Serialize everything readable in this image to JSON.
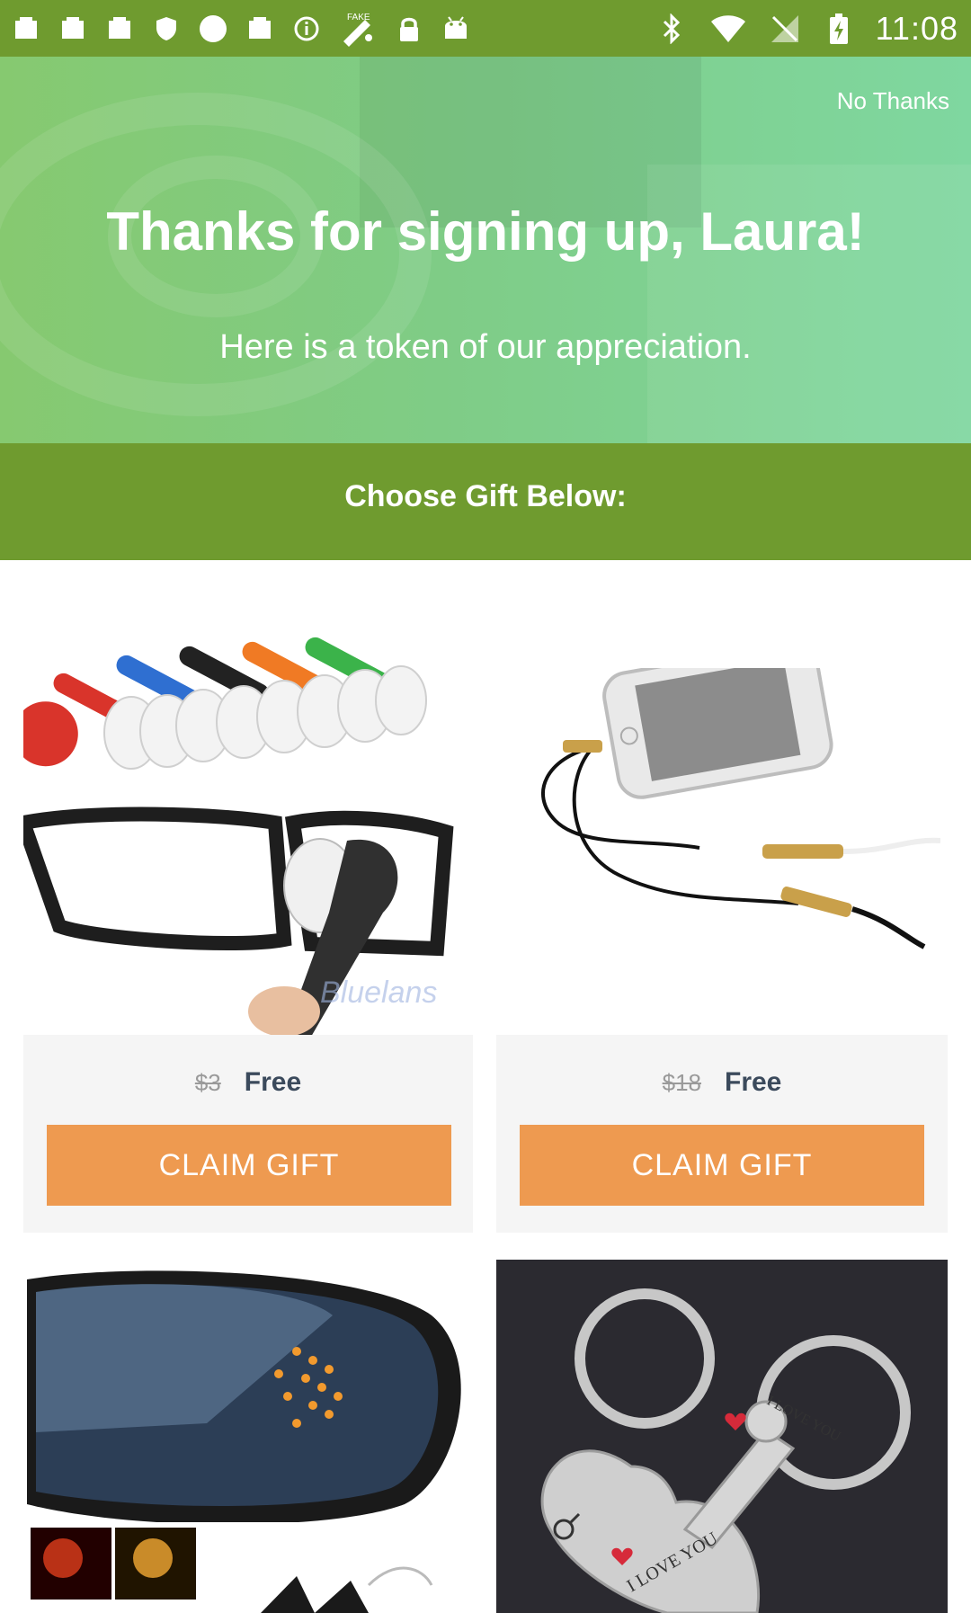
{
  "status_bar": {
    "time": "11:08",
    "left_icons": [
      "notification-icon",
      "notification-icon",
      "notification-icon",
      "shield-icon",
      "circle-icon",
      "notification-icon",
      "info-icon",
      "fake-gps-icon",
      "lock-icon",
      "android-icon"
    ],
    "right_icons": [
      "bluetooth-icon",
      "wifi-icon",
      "no-signal-icon",
      "battery-charging-icon"
    ],
    "fake_gps_label": "FAKE"
  },
  "overlay": {
    "no_thanks": "No Thanks",
    "title": "Thanks for signing up, Laura!",
    "subtitle": "Here is a token of our appreciation.",
    "choose_label": "Choose Gift Below:",
    "gifts": [
      {
        "old_price": "$3",
        "new_price": "Free",
        "button": "CLAIM GIFT",
        "image": "eyeglass-cleaner-clips"
      },
      {
        "old_price": "$18",
        "new_price": "Free",
        "button": "CLAIM GIFT",
        "image": "phone-audio-splitter-cable"
      },
      {
        "image": "car-mirror-turn-signal"
      },
      {
        "image": "heart-key-keychain"
      }
    ],
    "watermark": "Bluelans",
    "keychain_text": [
      "I LOVE YOU",
      "I LOVE YOU"
    ]
  },
  "colors": {
    "status_bar": "#6f9b2f",
    "band": "#6f9b2f",
    "button": "#ee9a50",
    "hero_start": "#86c970",
    "hero_end": "#7fd7a0"
  }
}
